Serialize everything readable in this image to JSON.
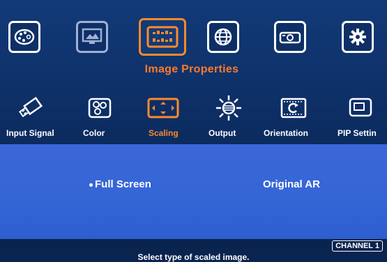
{
  "menu": {
    "title": "Image Properties",
    "top_icons": [
      {
        "name": "palette-icon"
      },
      {
        "name": "monitor-image-icon"
      },
      {
        "name": "image-properties-icon"
      },
      {
        "name": "globe-icon"
      },
      {
        "name": "projector-icon"
      },
      {
        "name": "gear-icon"
      }
    ]
  },
  "submenu": {
    "items": [
      {
        "label": "Input Signal",
        "icon": "usb-plug-icon"
      },
      {
        "label": "Color",
        "icon": "color-dials-icon"
      },
      {
        "label": "Scaling",
        "icon": "scaling-icon"
      },
      {
        "label": "Output",
        "icon": "sun-output-icon"
      },
      {
        "label": "Orientation",
        "icon": "rotate-icon"
      },
      {
        "label": "PIP Settin",
        "icon": "pip-icon"
      }
    ]
  },
  "scaling": {
    "options": [
      "Full Screen",
      "Original AR"
    ],
    "selected": "Full Screen"
  },
  "status": {
    "help_text": "Select type of scaled image.",
    "channel": "CHANNEL 1"
  },
  "colors": {
    "accent": "#ff8a2a",
    "content_bg": "#3566d6",
    "frame_bg": "#0e2f66"
  }
}
